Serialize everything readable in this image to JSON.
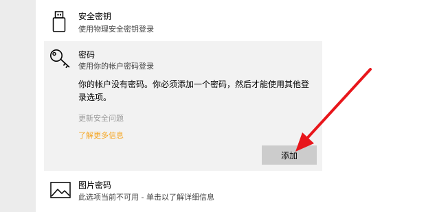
{
  "security_key": {
    "title": "安全密钥",
    "subtitle": "使用物理安全密钥登录",
    "icon": "usb-key-icon"
  },
  "password": {
    "title": "密码",
    "subtitle": "使用你的帐户密码登录",
    "icon": "key-icon",
    "message": "你的帐户没有密码。你必须添加一个密码，然后才能使用其他登录选项。",
    "update_security_questions": "更新安全问题",
    "learn_more": "了解更多信息",
    "add_button": "添加"
  },
  "picture_password": {
    "title": "图片密码",
    "subtitle": "此选项当前不可用 - 单击以了解详细信息",
    "icon": "picture-icon"
  },
  "colors": {
    "panel_background": "#f2f2f2",
    "link_accent": "#f5a623",
    "disabled_text": "#9a9a9a",
    "button_background": "#cccccc",
    "annotation_arrow": "#e8161b"
  }
}
